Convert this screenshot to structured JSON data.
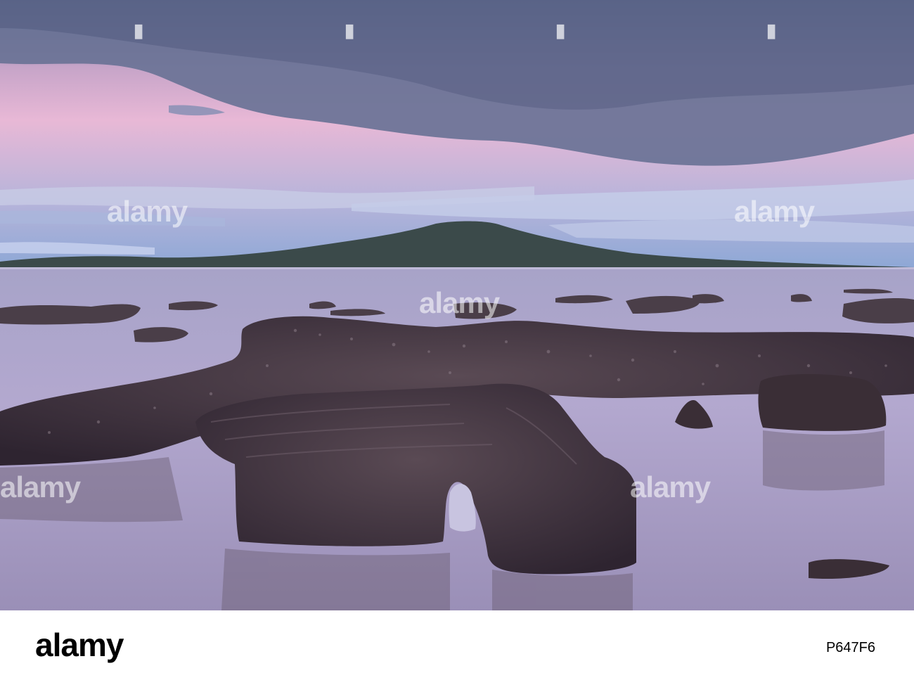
{
  "photo": {
    "watermark_text": "alamy"
  },
  "footer": {
    "brand": "alamy",
    "image_id": "P647F6"
  },
  "colors": {
    "sky_top": "#5b6688",
    "sky_pink": "#e8b8d6",
    "sky_blue": "#8ea8d6",
    "island": "#3b4a4a",
    "water": "#a9a2c6",
    "rock": "#3d3038"
  }
}
